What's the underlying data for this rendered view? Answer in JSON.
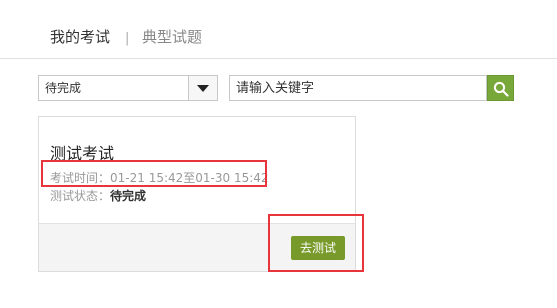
{
  "tabs": {
    "my_exam": "我的考试",
    "separator": "|",
    "typical_questions": "典型试题"
  },
  "filter": {
    "status_selected": "待完成",
    "search_placeholder": "请输入关键字"
  },
  "exam_card": {
    "title": "测试考试",
    "time_label": "考试时间：",
    "time_value": "01-21 15:42至01-30 15:42",
    "status_label": "测试状态：",
    "status_value": "待完成",
    "action_button": "去测试"
  },
  "colors": {
    "accent_green": "#789a2a",
    "search_green": "#78a83a",
    "highlight_red": "#e8343b"
  },
  "icons": {
    "dropdown": "caret-down-icon",
    "search": "magnifier-icon"
  }
}
